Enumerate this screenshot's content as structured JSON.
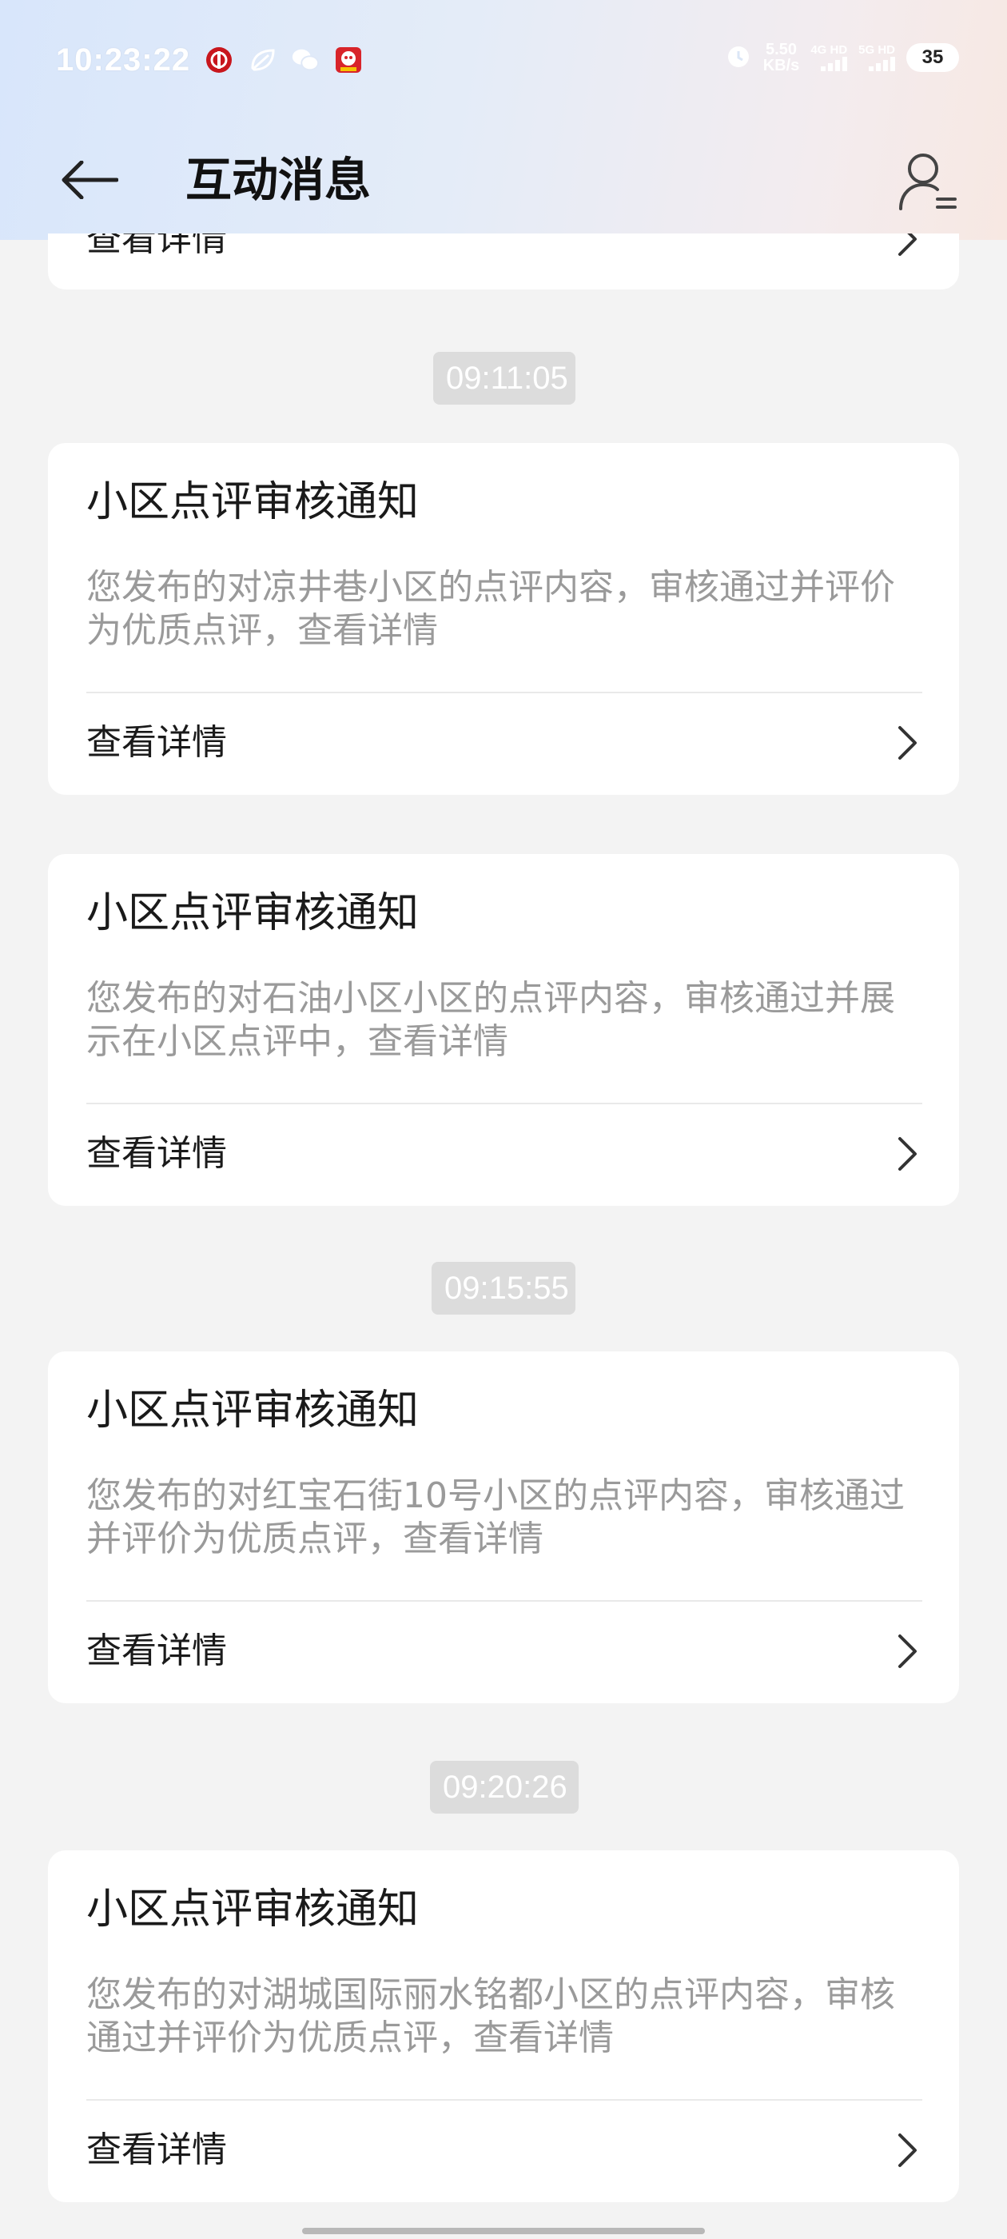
{
  "status_bar": {
    "time": "10:23:22",
    "network_speed_value": "5.50",
    "network_speed_unit": "KB/s",
    "signal1_label": "4G HD",
    "signal2_label": "5G HD",
    "battery_level": "35"
  },
  "header": {
    "title": "互动消息"
  },
  "partial_card": {
    "link_label": "查看详情"
  },
  "messages": [
    {
      "time": "09:11:05",
      "title": "小区点评审核通知",
      "body": "您发布的对凉井巷小区的点评内容，审核通过并评价为优质点评，查看详情",
      "link_label": "查看详情"
    },
    {
      "title": "小区点评审核通知",
      "body": "您发布的对石油小区小区的点评内容，审核通过并展示在小区点评中，查看详情",
      "link_label": "查看详情"
    },
    {
      "time": "09:15:55",
      "title": "小区点评审核通知",
      "body": "您发布的对红宝石街10号小区的点评内容，审核通过并评价为优质点评，查看详情",
      "link_label": "查看详情"
    },
    {
      "time": "09:20:26",
      "title": "小区点评审核通知",
      "body": "您发布的对湖城国际丽水铭都小区的点评内容，审核通过并评价为优质点评，查看详情",
      "link_label": "查看详情"
    }
  ],
  "colors": {
    "background": "#f3f3f3",
    "card": "#ffffff",
    "secondary_text": "#9a9a9a",
    "time_chip": "#dcdcdc"
  }
}
